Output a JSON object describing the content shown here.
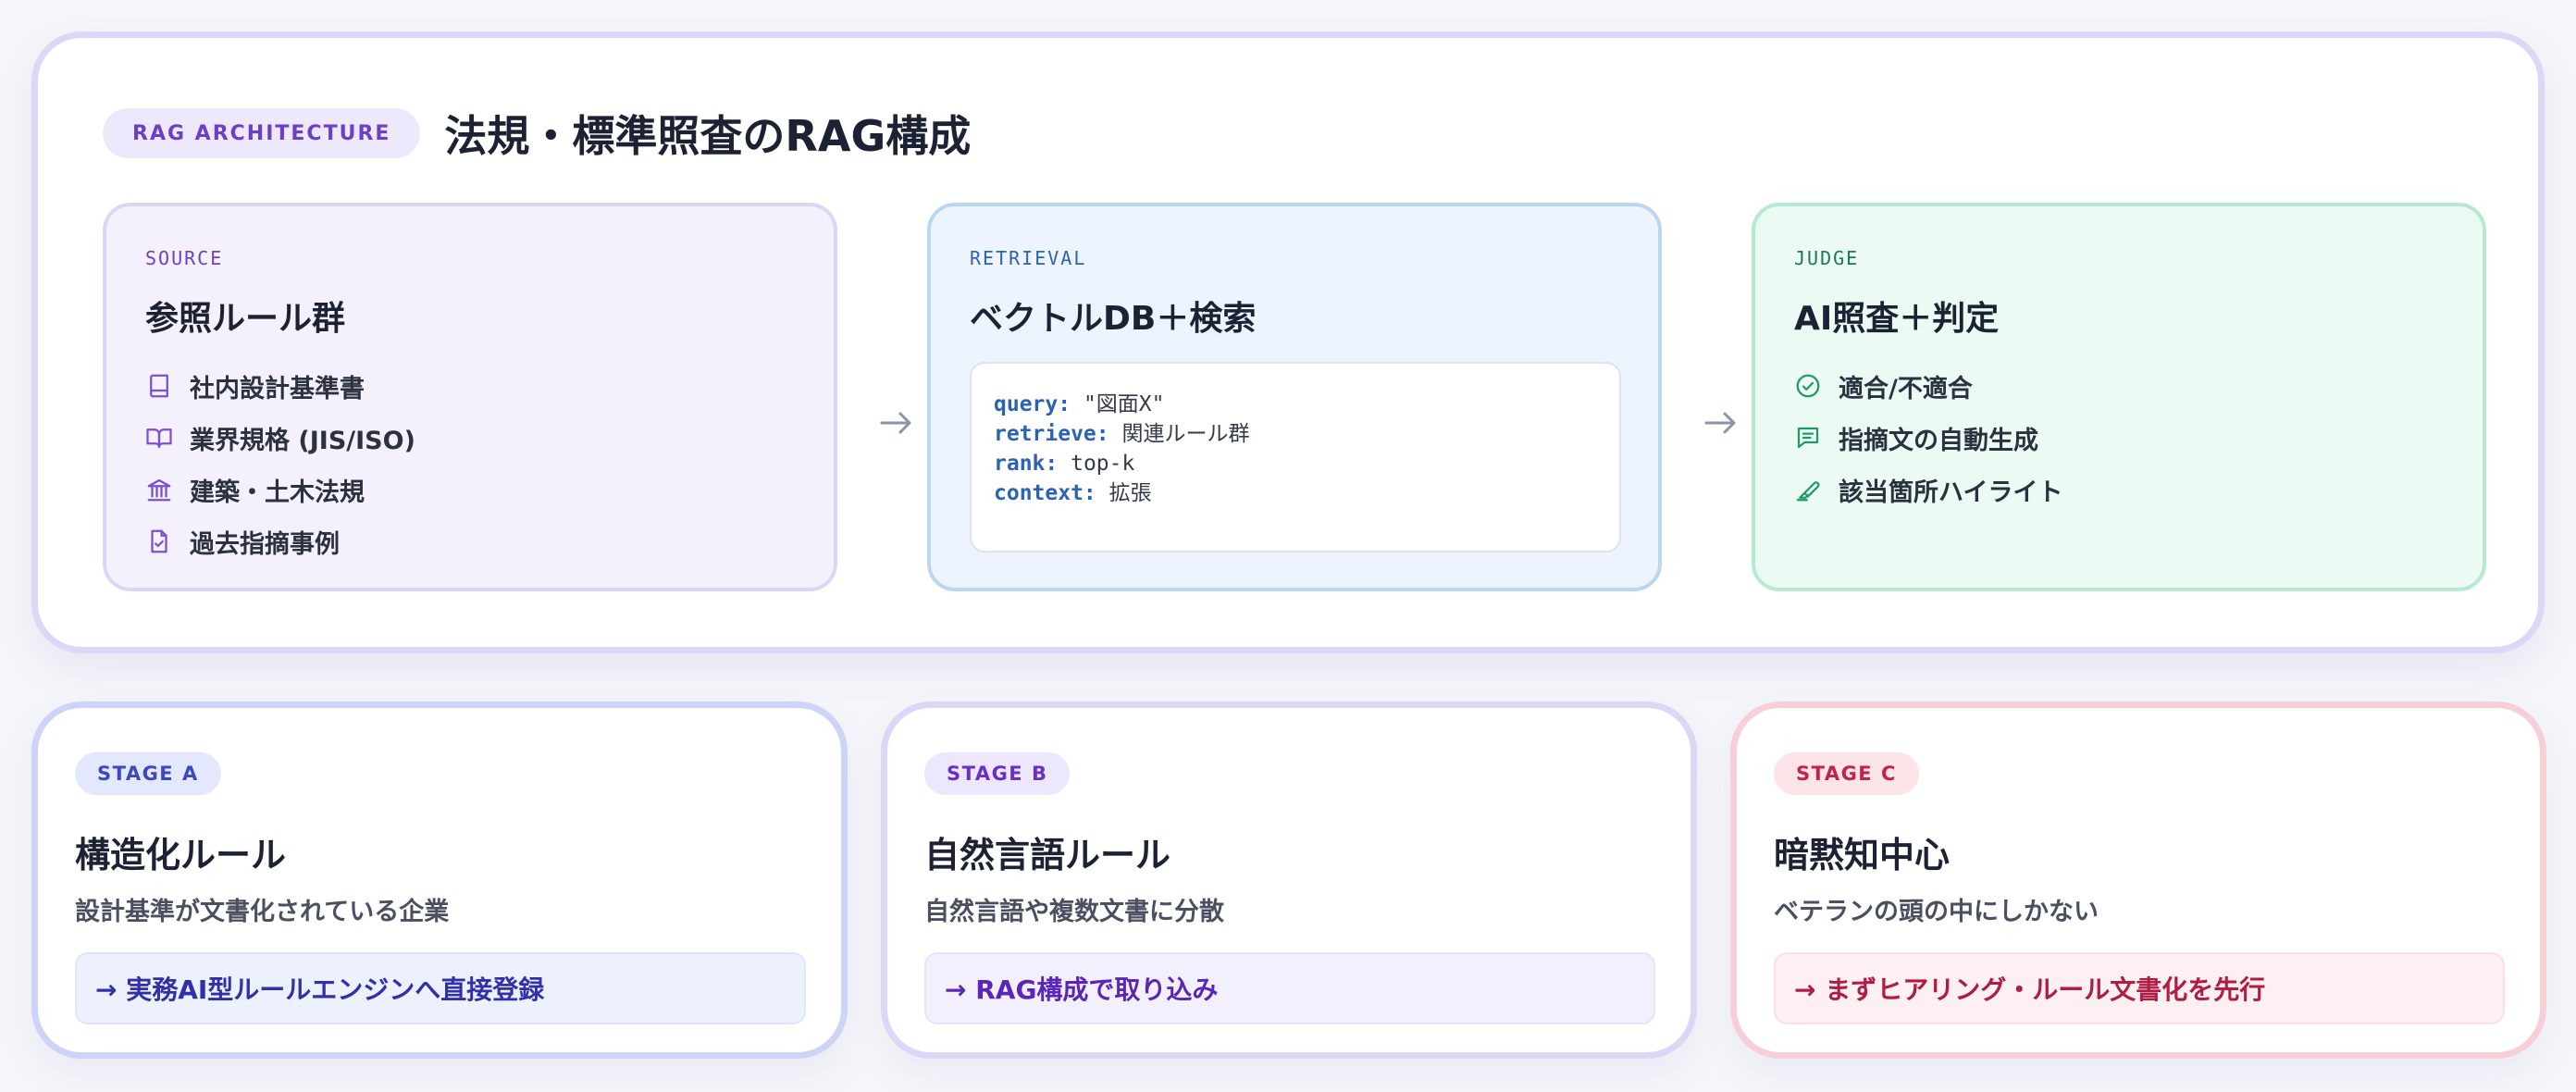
{
  "architecture": {
    "tag": "RAG ARCHITECTURE",
    "title": "法規・標準照査のRAG構成",
    "source": {
      "label": "SOURCE",
      "title": "参照ルール群",
      "items": [
        {
          "icon": "book-icon",
          "label": "社内設計基準書"
        },
        {
          "icon": "open-book-icon",
          "label": "業界規格 (JIS/ISO)"
        },
        {
          "icon": "building-columns-icon",
          "label": "建築・土木法規"
        },
        {
          "icon": "document-check-icon",
          "label": "過去指摘事例"
        }
      ]
    },
    "retrieval": {
      "label": "RETRIEVAL",
      "title": "ベクトルDB＋検索",
      "code": [
        {
          "key": "query:",
          "value": " \"図面X\""
        },
        {
          "key": "retrieve:",
          "value": " 関連ルール群"
        },
        {
          "key": "rank:",
          "value": " top-k"
        },
        {
          "key": "context:",
          "value": " 拡張"
        }
      ]
    },
    "judge": {
      "label": "JUDGE",
      "title": "AI照査＋判定",
      "items": [
        {
          "icon": "check-circle-icon",
          "label": "適合/不適合"
        },
        {
          "icon": "message-lines-icon",
          "label": "指摘文の自動生成"
        },
        {
          "icon": "highlighter-icon",
          "label": "該当箇所ハイライト"
        }
      ]
    }
  },
  "stages": [
    {
      "tag": "STAGE A",
      "title": "構造化ルール",
      "desc": "設計基準が文書化されている企業",
      "action": "→ 実務AI型ルールエンジンへ直接登録"
    },
    {
      "tag": "STAGE B",
      "title": "自然言語ルール",
      "desc": "自然言語や複数文書に分散",
      "action": "→ RAG構成で取り込み"
    },
    {
      "tag": "STAGE C",
      "title": "暗黙知中心",
      "desc": "ベテランの頭の中にしかない",
      "action": "→ まずヒアリング・ルール文書化を先行"
    }
  ],
  "colors": {
    "source_accent": "#7b4fd4",
    "retrieval_accent": "#2b63b3",
    "judge_accent": "#1f9a66",
    "stage_a": "#3d47c0",
    "stage_b": "#6b2fc8",
    "stage_c": "#c0244a"
  }
}
